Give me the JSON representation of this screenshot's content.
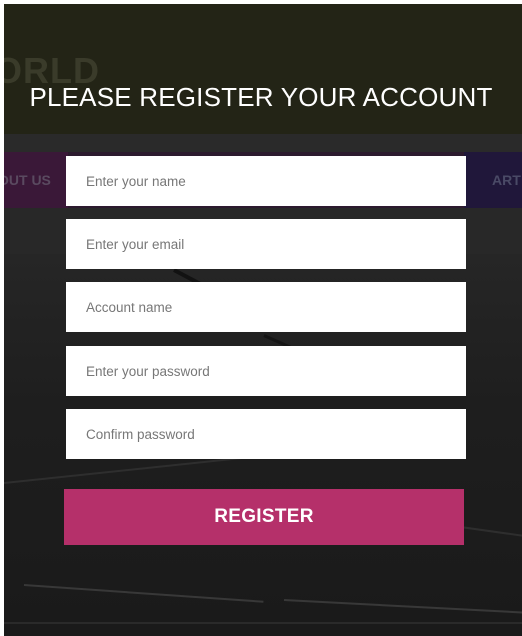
{
  "background": {
    "logo_fragment": "ORLD",
    "nav_left_fragment": "OUT US",
    "nav_right_fragment": "ART"
  },
  "modal": {
    "title": "PLEASE REGISTER YOUR ACCOUNT",
    "fields": {
      "name": {
        "placeholder": "Enter your name",
        "value": ""
      },
      "email": {
        "placeholder": "Enter your email",
        "value": ""
      },
      "account": {
        "placeholder": "Account name",
        "value": ""
      },
      "password": {
        "placeholder": "Enter your password",
        "value": ""
      },
      "confirm": {
        "placeholder": "Confirm password",
        "value": ""
      }
    },
    "register_label": "REGISTER"
  },
  "colors": {
    "accent": "#b5306a",
    "overlay": "#222222",
    "title_text": "#ffffff"
  }
}
